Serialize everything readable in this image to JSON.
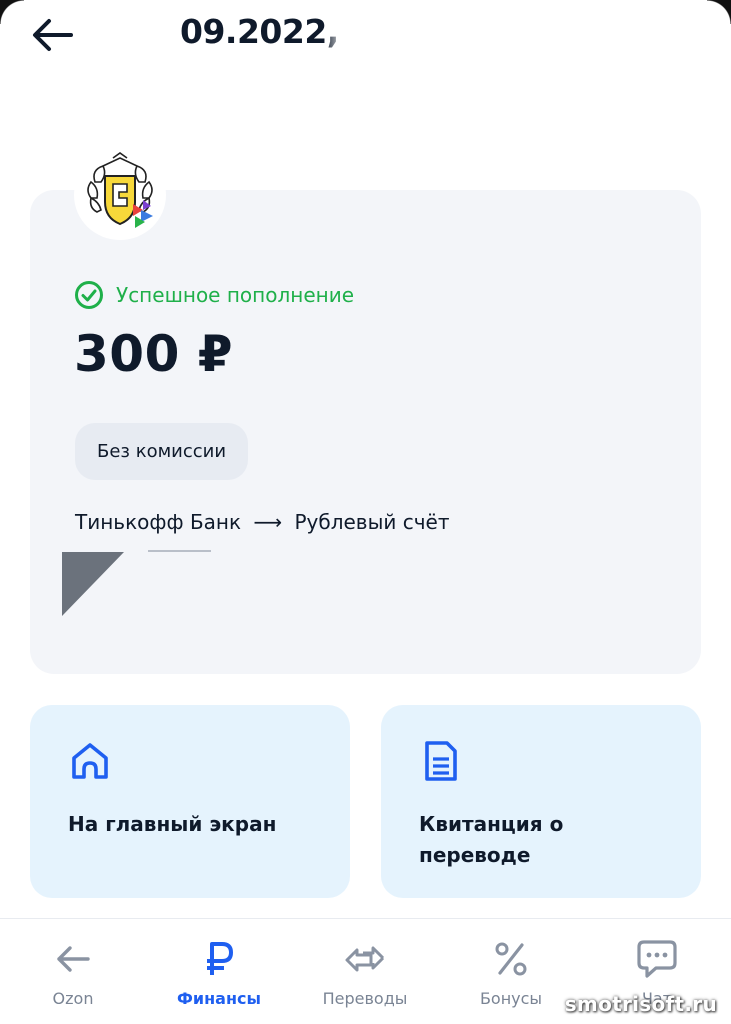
{
  "header": {
    "title": "09.2022, "
  },
  "card": {
    "status": "Успешное пополнение",
    "amount": "300 ₽",
    "commission": "Без комиссии",
    "route_from": "Тинькофф Банк",
    "route_arrow": "⟶",
    "route_to": "Рублевый счёт"
  },
  "actions": {
    "home_label": "На главный экран",
    "receipt_label": "Квитанция о переводе"
  },
  "tabs": [
    {
      "label": "Ozon",
      "icon": "arrow-left-icon",
      "active": false
    },
    {
      "label": "Финансы",
      "icon": "ruble-icon",
      "active": true
    },
    {
      "label": "Переводы",
      "icon": "transfer-arrows-icon",
      "active": false
    },
    {
      "label": "Бонусы",
      "icon": "percent-icon",
      "active": false
    },
    {
      "label": "Чат",
      "icon": "chat-icon",
      "active": false
    }
  ],
  "watermark": "smotrisoft.ru",
  "colors": {
    "success": "#1fb04a",
    "accent": "#1f5ff0",
    "tile_bg": "#e5f3fd",
    "card_bg": "#f3f5f9"
  }
}
